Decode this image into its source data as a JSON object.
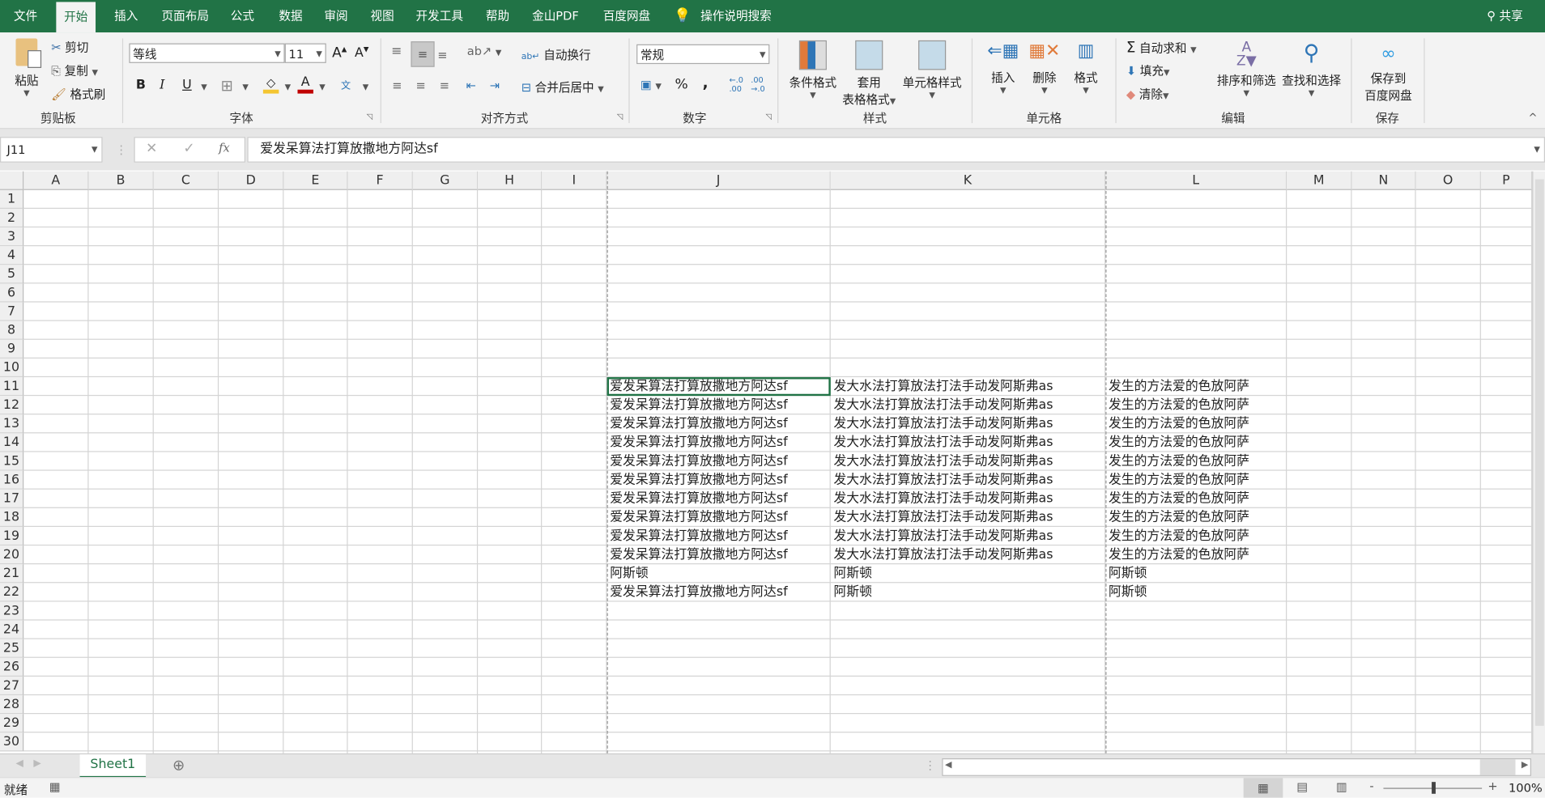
{
  "menu_tabs": [
    "文件",
    "开始",
    "插入",
    "页面布局",
    "公式",
    "数据",
    "审阅",
    "视图",
    "开发工具",
    "帮助",
    "金山PDF",
    "百度网盘"
  ],
  "active_tab": "开始",
  "tell_me": "操作说明搜索",
  "share": "共享",
  "ribbon": {
    "clipboard": {
      "paste": "粘贴",
      "cut": "剪切",
      "copy": "复制",
      "format_painter": "格式刷",
      "label": "剪贴板"
    },
    "font": {
      "name": "等线",
      "size": "11",
      "bold": "B",
      "italic": "I",
      "underline": "U",
      "label": "字体"
    },
    "alignment": {
      "wrap": "自动换行",
      "merge": "合并后居中",
      "label": "对齐方式"
    },
    "number": {
      "format": "常规",
      "percent": "%",
      "comma": ",",
      "label": "数字"
    },
    "styles": {
      "conditional": "条件格式",
      "table_line1": "套用",
      "table_line2": "表格格式",
      "cell_styles": "单元格样式",
      "label": "样式"
    },
    "cells": {
      "insert": "插入",
      "delete": "删除",
      "format": "格式",
      "label": "单元格"
    },
    "editing": {
      "autosum": "自动求和",
      "fill": "填充",
      "clear": "清除",
      "sort": "排序和筛选",
      "find": "查找和选择",
      "label": "编辑"
    },
    "save": {
      "line1": "保存到",
      "line2": "百度网盘",
      "label": "保存"
    }
  },
  "formula_bar": {
    "name_box": "J11",
    "fx": "fx",
    "content": "爱发呆算法打算放撒地方阿达sf"
  },
  "grid": {
    "columns": [
      "A",
      "B",
      "C",
      "D",
      "E",
      "F",
      "G",
      "H",
      "I",
      "J",
      "K",
      "L",
      "M",
      "N",
      "O",
      "P"
    ],
    "rows": [
      "1",
      "2",
      "3",
      "4",
      "5",
      "6",
      "7",
      "8",
      "9",
      "10",
      "11",
      "12",
      "13",
      "14",
      "15",
      "16",
      "17",
      "18",
      "19",
      "20",
      "21",
      "22",
      "23",
      "24",
      "25",
      "26",
      "27",
      "28",
      "29",
      "30"
    ],
    "cells": {
      "J11": "爱发呆算法打算放撒地方阿达sf",
      "K11": "发大水法打算放法打法手动发阿斯弗as",
      "L11": "发生的方法爱的色放阿萨",
      "J12": "爱发呆算法打算放撒地方阿达sf",
      "K12": "发大水法打算放法打法手动发阿斯弗as",
      "L12": "发生的方法爱的色放阿萨",
      "J13": "爱发呆算法打算放撒地方阿达sf",
      "K13": "发大水法打算放法打法手动发阿斯弗as",
      "L13": "发生的方法爱的色放阿萨",
      "J14": "爱发呆算法打算放撒地方阿达sf",
      "K14": "发大水法打算放法打法手动发阿斯弗as",
      "L14": "发生的方法爱的色放阿萨",
      "J15": "爱发呆算法打算放撒地方阿达sf",
      "K15": "发大水法打算放法打法手动发阿斯弗as",
      "L15": "发生的方法爱的色放阿萨",
      "J16": "爱发呆算法打算放撒地方阿达sf",
      "K16": "发大水法打算放法打法手动发阿斯弗as",
      "L16": "发生的方法爱的色放阿萨",
      "J17": "爱发呆算法打算放撒地方阿达sf",
      "K17": "发大水法打算放法打法手动发阿斯弗as",
      "L17": "发生的方法爱的色放阿萨",
      "J18": "爱发呆算法打算放撒地方阿达sf",
      "K18": "发大水法打算放法打法手动发阿斯弗as",
      "L18": "发生的方法爱的色放阿萨",
      "J19": "爱发呆算法打算放撒地方阿达sf",
      "K19": "发大水法打算放法打法手动发阿斯弗as",
      "L19": "发生的方法爱的色放阿萨",
      "J20": "爱发呆算法打算放撒地方阿达sf",
      "K20": "发大水法打算放法打法手动发阿斯弗as",
      "L20": "发生的方法爱的色放阿萨",
      "J21": "阿斯顿",
      "K21": "阿斯顿",
      "L21": "阿斯顿",
      "J22": "爱发呆算法打算放撒地方阿达sf",
      "K22": "阿斯顿",
      "L22": "阿斯顿"
    }
  },
  "sheet_tabs": [
    "Sheet1"
  ],
  "status": {
    "ready": "就绪",
    "zoom": "100%"
  },
  "colors": {
    "brand": "#217346"
  }
}
